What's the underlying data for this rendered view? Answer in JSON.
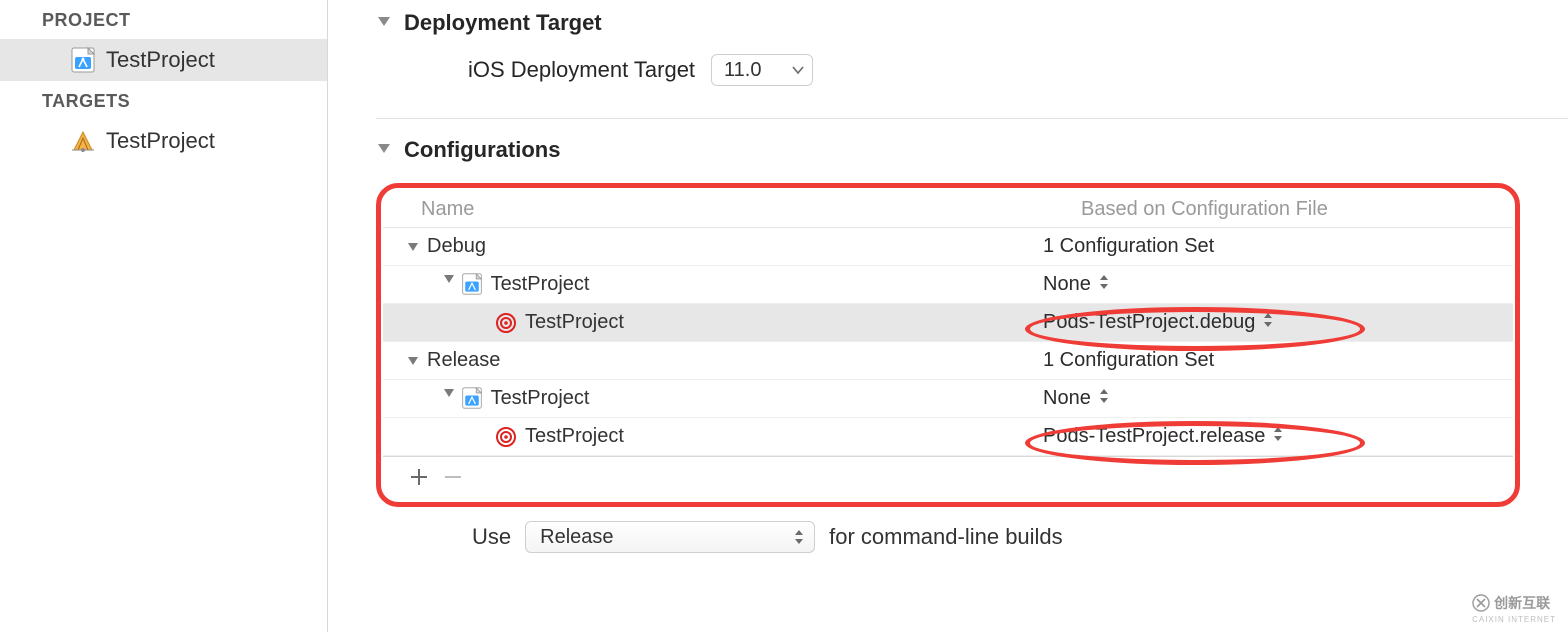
{
  "sidebar": {
    "project_header": "PROJECT",
    "project_name": "TestProject",
    "targets_header": "TARGETS",
    "target_name": "TestProject"
  },
  "deployment": {
    "section_title": "Deployment Target",
    "label": "iOS Deployment Target",
    "value": "11.0"
  },
  "configurations": {
    "section_title": "Configurations",
    "columns": {
      "name": "Name",
      "based": "Based on Configuration File"
    },
    "rows": [
      {
        "type": "config",
        "name": "Debug",
        "right": "1 Configuration Set"
      },
      {
        "type": "project",
        "name": "TestProject",
        "right": "None"
      },
      {
        "type": "target",
        "name": "TestProject",
        "right": "Pods-TestProject.debug",
        "selected": true,
        "highlight": true
      },
      {
        "type": "config",
        "name": "Release",
        "right": "1 Configuration Set"
      },
      {
        "type": "project",
        "name": "TestProject",
        "right": "None"
      },
      {
        "type": "target",
        "name": "TestProject",
        "right": "Pods-TestProject.release",
        "highlight": true
      }
    ],
    "use_label": "Use",
    "use_value": "Release",
    "use_suffix": "for command-line builds"
  },
  "watermark": {
    "brand": "创新互联",
    "sub": "CAIXIN INTERNET"
  }
}
